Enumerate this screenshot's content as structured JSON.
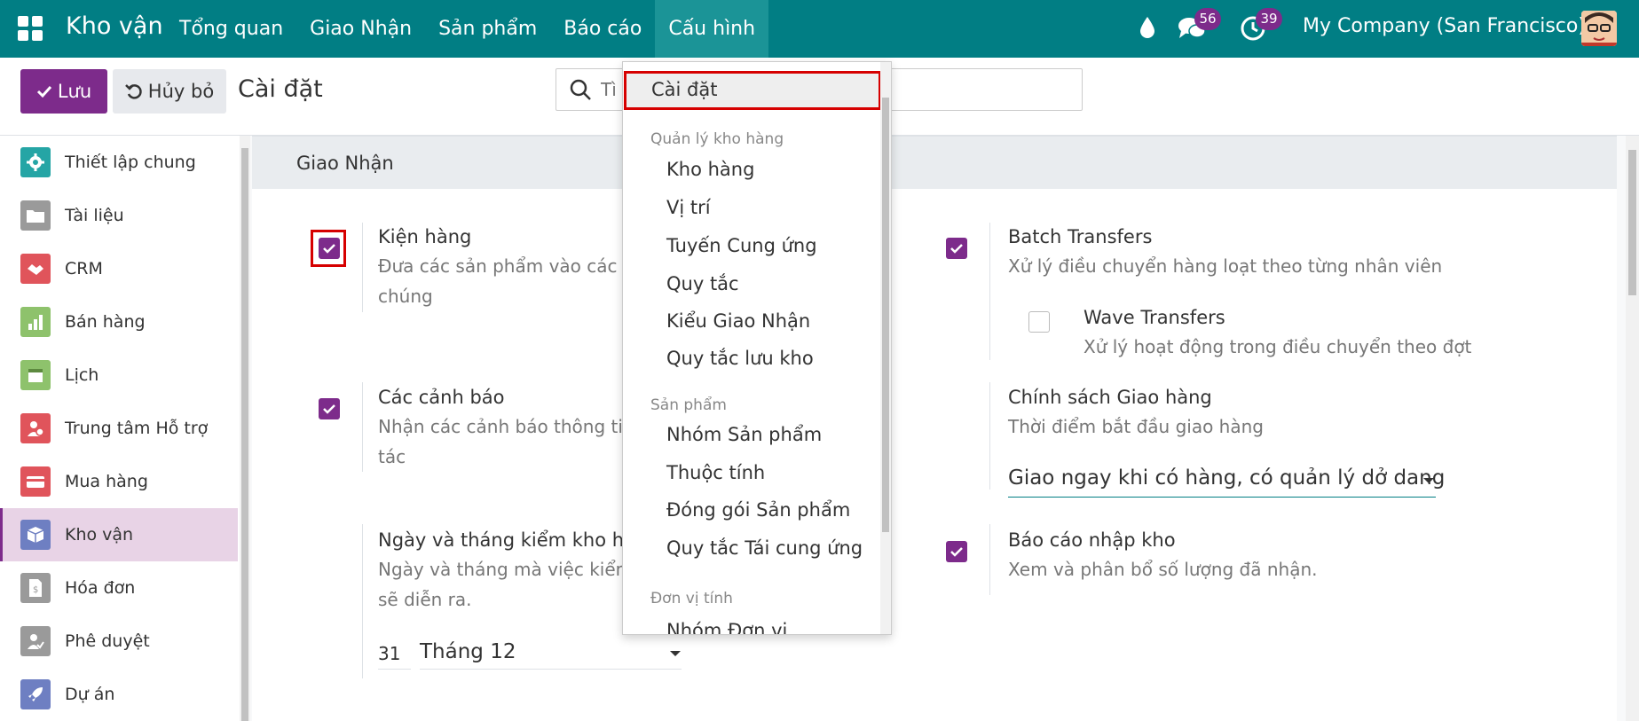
{
  "navbar": {
    "brand": "Kho vận",
    "menu": [
      "Tổng quan",
      "Giao Nhận",
      "Sản phẩm",
      "Báo cáo",
      "Cấu hình"
    ],
    "active_menu": "Cấu hình",
    "messages_count": "56",
    "activities_count": "39",
    "company": "My Company (San Francisco)"
  },
  "control": {
    "save_label": "Lưu",
    "discard_label": "Hủy bỏ",
    "title": "Cài đặt",
    "search_placeholder": "Tì"
  },
  "sidebar": {
    "items": [
      {
        "label": "Thiết lập chung",
        "icon": "gear-icon",
        "color": "#25a5a5"
      },
      {
        "label": "Tài liệu",
        "icon": "folder-icon",
        "color": "#9a9a9a"
      },
      {
        "label": "CRM",
        "icon": "handshake-icon",
        "color": "#e0545b"
      },
      {
        "label": "Bán hàng",
        "icon": "chart-icon",
        "color": "#8ec26c"
      },
      {
        "label": "Lịch",
        "icon": "calendar-icon",
        "color": "#8ec26c"
      },
      {
        "label": "Trung tâm Hỗ trợ",
        "icon": "support-icon",
        "color": "#e0545b"
      },
      {
        "label": "Mua hàng",
        "icon": "card-icon",
        "color": "#e0545b"
      },
      {
        "label": "Kho vận",
        "icon": "box-icon",
        "color": "#6e7fc2"
      },
      {
        "label": "Hóa đơn",
        "icon": "invoice-icon",
        "color": "#9a9a9a"
      },
      {
        "label": "Phê duyệt",
        "icon": "approval-icon",
        "color": "#9a9a9a"
      },
      {
        "label": "Dự án",
        "icon": "rocket-icon",
        "color": "#6e7fc2"
      }
    ],
    "active_index": 7
  },
  "section": {
    "title": "Giao Nhận"
  },
  "settings": {
    "packages": {
      "title": "Kiện hàng",
      "desc_line1": "Đưa các sản phẩm vào các",
      "desc_line2": "chúng",
      "checked": true
    },
    "warnings": {
      "title": "Các cảnh báo",
      "desc_line1": "Nhận các cảnh báo thông ti",
      "desc_line2": "tác",
      "checked": true
    },
    "inventory_date": {
      "title": "Ngày và tháng kiểm kho hàn",
      "desc_line1": "Ngày và tháng mà việc kiểm",
      "desc_line2": "sẽ diễn ra.",
      "day": "31",
      "month": "Tháng 12"
    },
    "batch": {
      "title": "Batch Transfers",
      "desc": "Xử lý điều chuyển hàng loạt theo từng nhân viên",
      "checked": true
    },
    "wave": {
      "title": "Wave Transfers",
      "desc": "Xử lý hoạt động trong điều chuyển theo đợt",
      "checked": false
    },
    "delivery_policy": {
      "title": "Chính sách Giao hàng",
      "desc": "Thời điểm bắt đầu giao hàng",
      "value": "Giao ngay khi có hàng, có quản lý dở dang"
    },
    "receipt_report": {
      "title": "Báo cáo nhập kho",
      "desc": "Xem và phân bổ số lượng đã nhận.",
      "checked": true
    }
  },
  "dropdown": {
    "first": "Cài đặt",
    "group1_header": "Quản lý kho hàng",
    "group1": [
      "Kho hàng",
      "Vị trí",
      "Tuyến Cung ứng",
      "Quy tắc",
      "Kiểu Giao Nhận",
      "Quy tắc lưu kho"
    ],
    "group2_header": "Sản phẩm",
    "group2": [
      "Nhóm Sản phẩm",
      "Thuộc tính",
      "Đóng gói Sản phẩm",
      "Quy tắc Tái cung ứng"
    ],
    "group3_header": "Đơn vị tính",
    "group3": [
      "Nhóm Đơn vị"
    ]
  },
  "colors": {
    "navbar": "#017e84",
    "accent": "#7d2b8b",
    "highlight": "#d60000"
  }
}
